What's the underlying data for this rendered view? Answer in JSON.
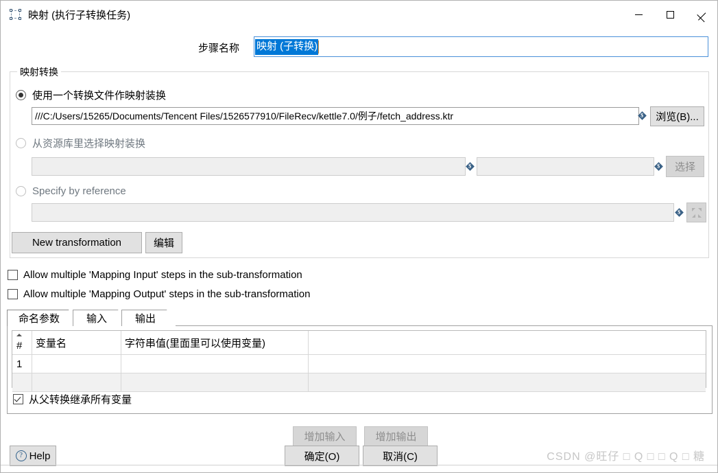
{
  "window": {
    "title": "映射 (执行子转换任务)",
    "icon": "transformation-step-icon",
    "minimize": "—",
    "maximize": "□",
    "close": "✕"
  },
  "step_name": {
    "label": "步骤名称",
    "value": "映射 (子转换)",
    "selected": true
  },
  "group": {
    "title": "映射转换",
    "option_file": {
      "label": "使用一个转换文件作映射装换",
      "checked": true,
      "path": "///C:/Users/15265/Documents/Tencent Files/1526577910/FileRecv/kettle7.0/例子/fetch_address.ktr",
      "browse_label": "浏览(B)..."
    },
    "option_repository": {
      "label": "从资源库里选择映射装换",
      "checked": false,
      "dir_value": "",
      "name_value": "",
      "select_label": "选择"
    },
    "option_reference": {
      "label": "Specify by reference",
      "checked": false,
      "value": ""
    },
    "new_transformation_label": "New transformation",
    "edit_label": "编辑"
  },
  "checkboxes": {
    "allow_multiple_input": {
      "label": "Allow multiple 'Mapping Input' steps in the sub-transformation",
      "checked": false
    },
    "allow_multiple_output": {
      "label": "Allow multiple 'Mapping Output' steps in the sub-transformation",
      "checked": false
    },
    "inherit_all_variables": {
      "label": "从父转换继承所有变量",
      "checked": true
    }
  },
  "tabs": [
    {
      "label": "命名参数",
      "selected": true
    },
    {
      "label": "输入",
      "selected": false
    },
    {
      "label": "输出",
      "selected": false
    }
  ],
  "table": {
    "columns": [
      "#",
      "变量名",
      "字符串值(里面里可以使用变量)",
      ""
    ],
    "rows": [
      {
        "num": "1",
        "var": "",
        "val": "",
        "rest": ""
      },
      {
        "num": "",
        "var": "",
        "val": "",
        "rest": ""
      }
    ]
  },
  "footer": {
    "help_label": "Help",
    "add_input_label": "增加输入",
    "add_output_label": "增加输出",
    "ok_label": "确定(O)",
    "cancel_label": "取消(C)",
    "watermark": "CSDN @旺仔 □ Q □ □ Q □ 糖"
  },
  "colors": {
    "selection_blue": "#0078d7",
    "focus_border": "#4a90d9",
    "button_face": "#e1e1e1",
    "variable_marker": "#3a6186"
  }
}
